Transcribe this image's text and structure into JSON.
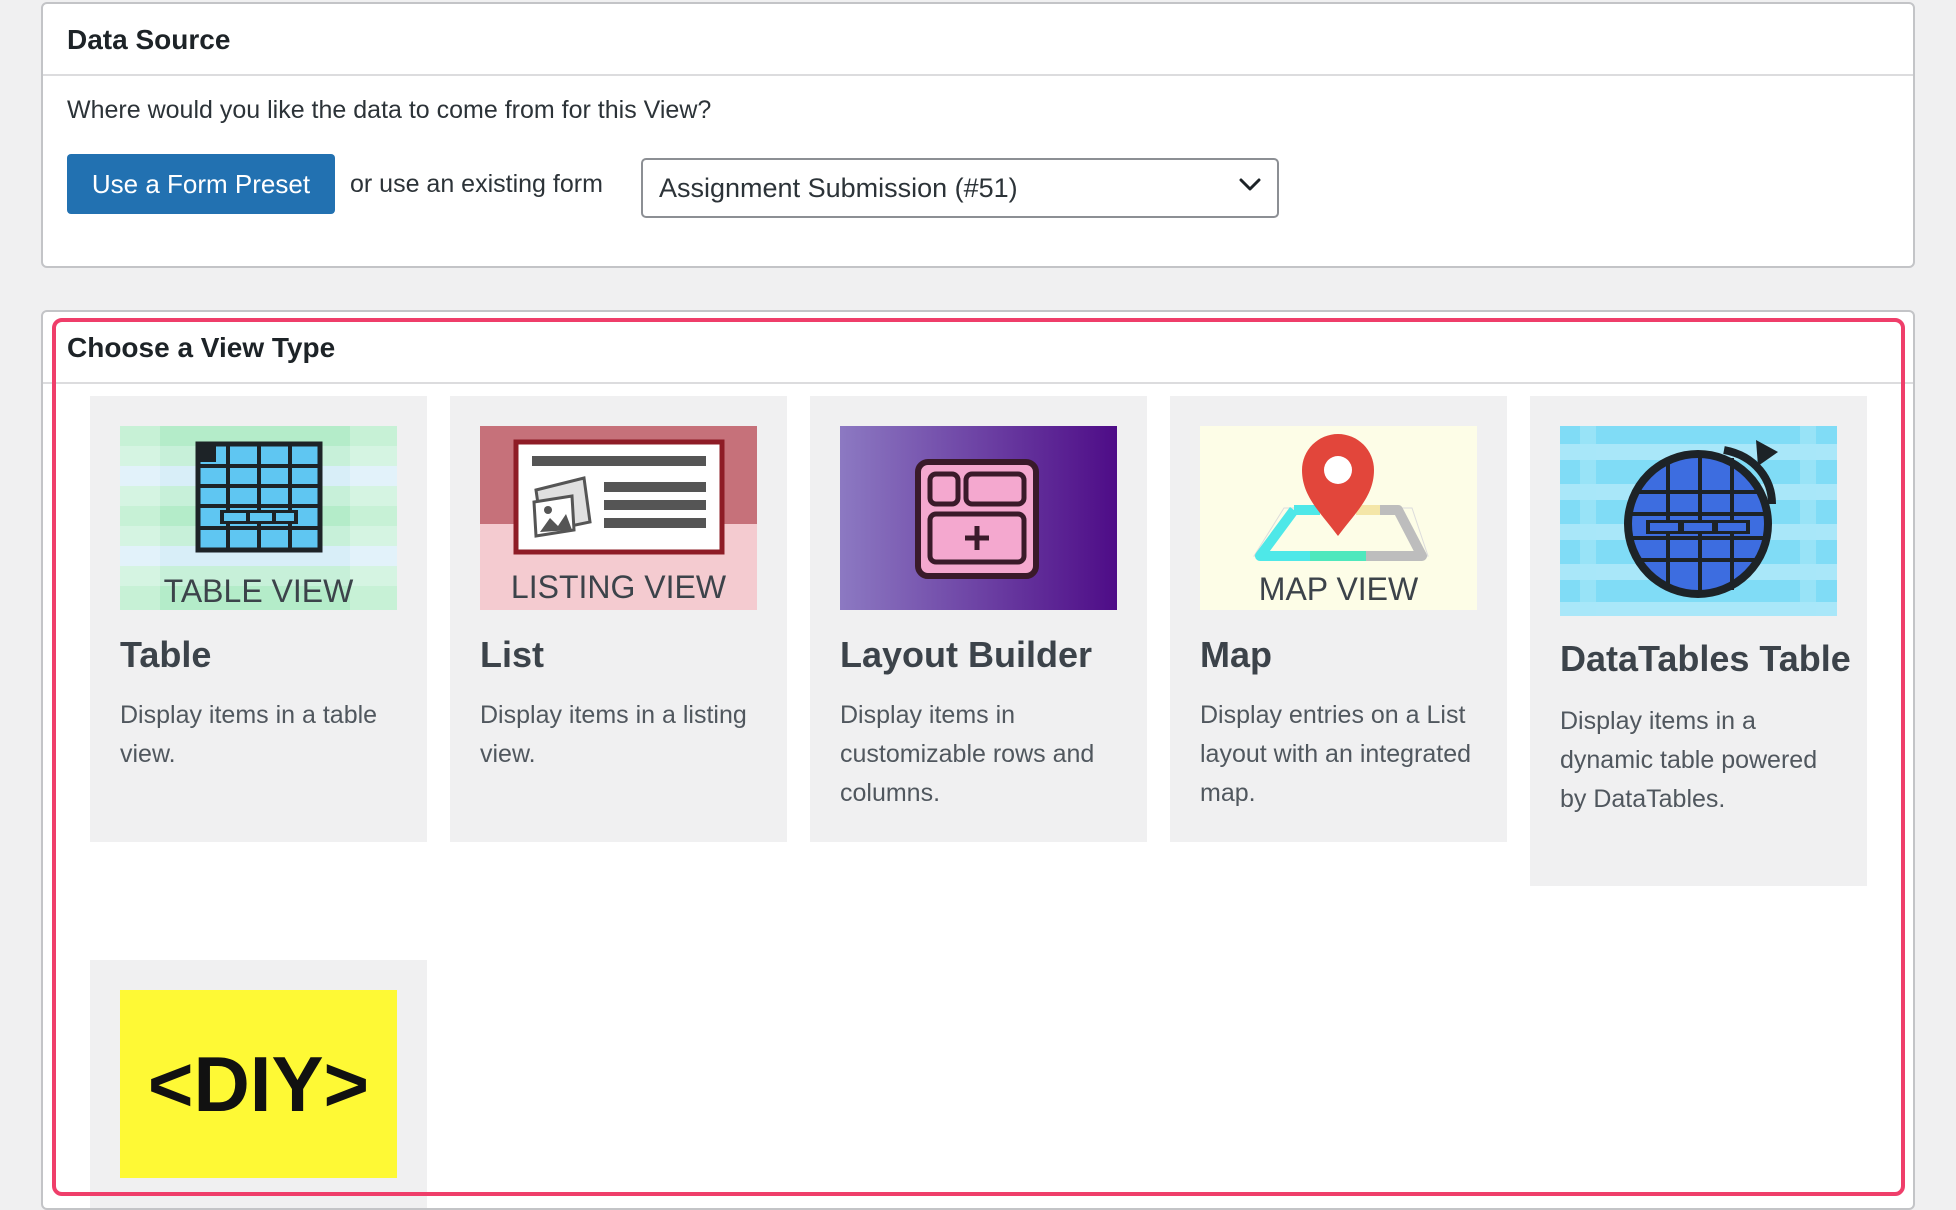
{
  "data_source": {
    "title": "Data Source",
    "question": "Where would you like the data to come from for this View?",
    "preset_button": "Use a Form Preset",
    "or_text": "or use an existing form",
    "selected_form": "Assignment Submission (#51)"
  },
  "view_type": {
    "title": "Choose a View Type",
    "highlight_color": "#ef3e6a",
    "cards": [
      {
        "img_label": "TABLE VIEW",
        "title": "Table",
        "desc": "Display items in a table view.",
        "icon": "table-view-icon"
      },
      {
        "img_label": "LISTING VIEW",
        "title": "List",
        "desc": "Display items in a listing view.",
        "icon": "listing-view-icon"
      },
      {
        "title": "Layout Builder",
        "desc": "Display items in customizable rows and columns.",
        "icon": "layout-builder-icon"
      },
      {
        "img_label": "MAP VIEW",
        "title": "Map",
        "desc": "Display entries on a List layout with an integrated map.",
        "icon": "map-view-icon"
      },
      {
        "title": "DataTables Table",
        "desc": "Display items in a dynamic table powered by DataTables.",
        "icon": "datatables-icon"
      },
      {
        "img_label": "<DIY>",
        "icon": "diy-icon"
      }
    ]
  },
  "colors": {
    "primary_button": "#2271b1",
    "card_bg": "#f0f0f1",
    "diy_yellow": "#fef935"
  }
}
